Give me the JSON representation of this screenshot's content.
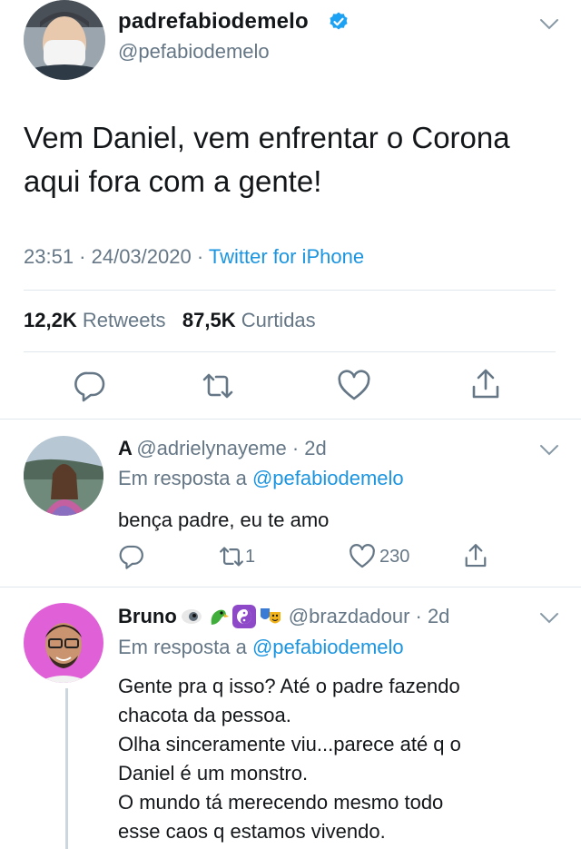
{
  "main_tweet": {
    "display_name": "padrefabiodemelo",
    "handle": "@pefabiodemelo",
    "text_line1": "Vem Daniel, vem enfrentar o Corona",
    "text_line2": "aqui fora com a gente!",
    "time": "23:51 · 24/03/2020 ·",
    "source": "Twitter for iPhone",
    "retweets_count": "12,2K",
    "retweets_label": "Retweets",
    "likes_count": "87,5K",
    "likes_label": "Curtidas"
  },
  "replies": [
    {
      "display_name": "A",
      "handle_time": "@adrielynayeme · 2d",
      "reply_prefix": "Em resposta a",
      "reply_to": "@pefabiodemelo",
      "text": "bença padre, eu te amo",
      "retweet_count": "1",
      "like_count": "230"
    },
    {
      "display_name": "Bruno",
      "handle_time": "@brazdadour · 2d",
      "reply_prefix": "Em resposta a",
      "reply_to": "@pefabiodemelo",
      "text_lines": [
        "Gente pra q isso? Até o padre fazendo",
        "chacota da pessoa.",
        "Olha sinceramente viu...parece até q o",
        "Daniel é um monstro.",
        "O mundo tá merecendo mesmo todo",
        "esse caos q estamos vivendo."
      ]
    }
  ],
  "colors": {
    "link_blue": "#1b95e0",
    "secondary_grey": "#657786",
    "divider": "#e1e8ed",
    "verified_blue": "#1da1f2"
  },
  "icons": [
    "verified-badge-icon",
    "chevron-down-icon",
    "reply-icon",
    "retweet-icon",
    "like-icon",
    "share-icon"
  ]
}
